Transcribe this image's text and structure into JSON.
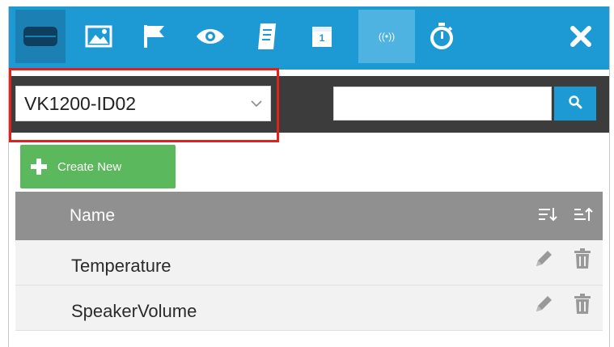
{
  "toolbar": {
    "buttons": [
      {
        "icon": "device-icon"
      },
      {
        "icon": "image-icon"
      },
      {
        "icon": "flag-icon"
      },
      {
        "icon": "eye-icon"
      },
      {
        "icon": "scroll-icon"
      },
      {
        "icon": "calendar-icon",
        "text": "1"
      },
      {
        "icon": "broadcast-icon",
        "text": "((•))",
        "active": true
      },
      {
        "icon": "stopwatch-icon"
      }
    ],
    "close_icon": "close-icon"
  },
  "filter": {
    "selected": "VK1200-ID02",
    "search_value": "",
    "search_icon": "search-icon"
  },
  "create_button": {
    "label": "Create New",
    "icon": "plus-icon"
  },
  "table": {
    "header": {
      "name": "Name",
      "sort_desc_icon": "sort-descending-icon",
      "sort_asc_icon": "sort-ascending-icon"
    },
    "rows": [
      {
        "name": "Temperature"
      },
      {
        "name": "SpeakerVolume"
      }
    ]
  },
  "colors": {
    "toolbar": "#1d9ad3",
    "filterbar": "#3c3c3c",
    "create": "#5cb85c",
    "header": "#909090",
    "highlight": "#e2211c"
  }
}
